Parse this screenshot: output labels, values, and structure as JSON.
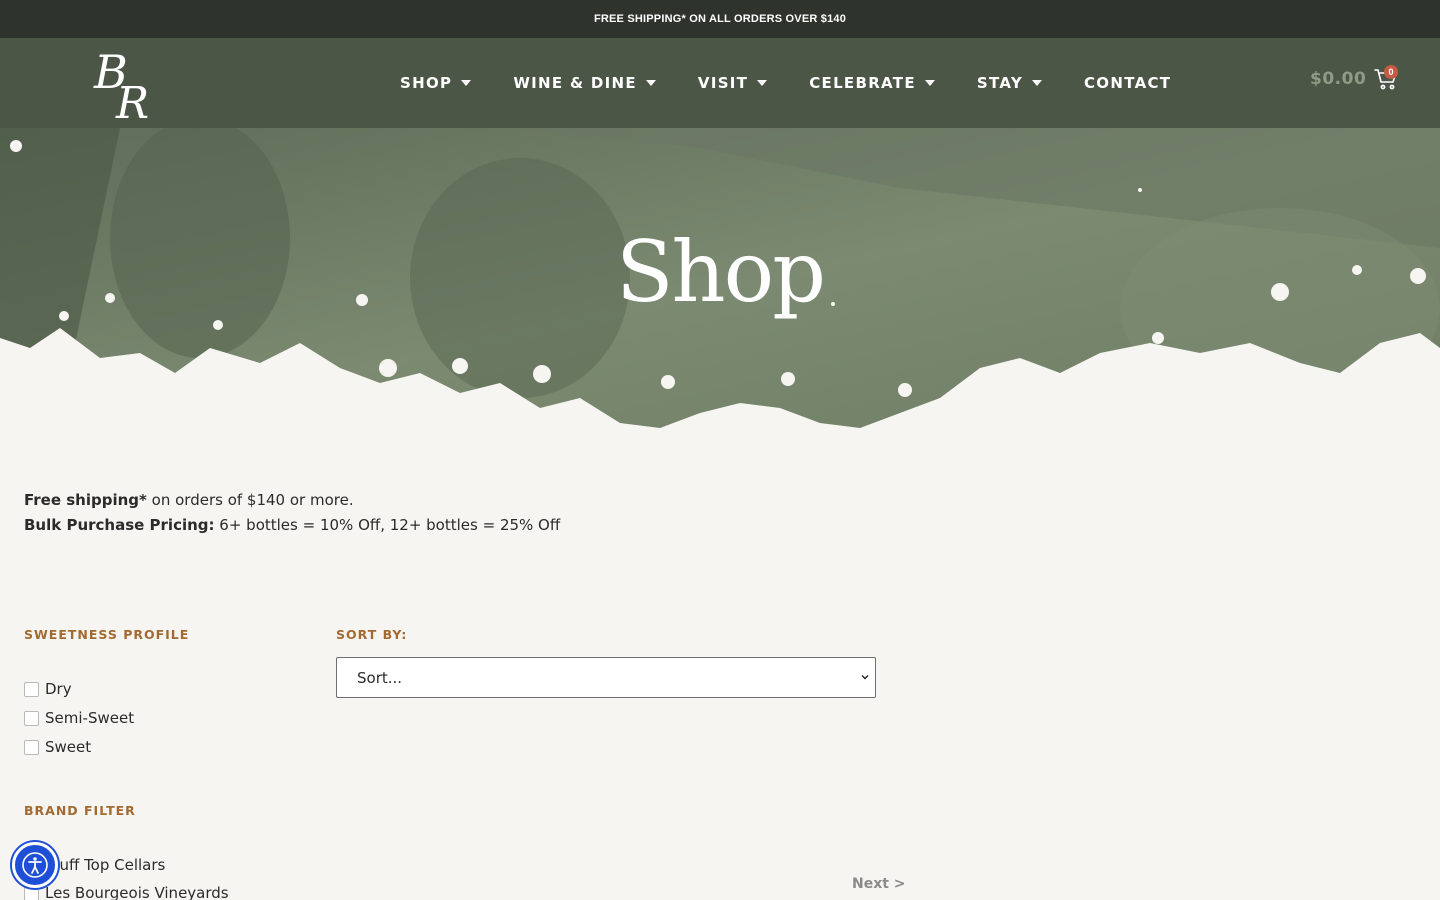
{
  "announcement": "FREE SHIPPING* ON ALL ORDERS OVER $140",
  "header": {
    "logo_text": "BR",
    "nav": [
      {
        "label": "SHOP",
        "has_dropdown": true
      },
      {
        "label": "WINE & DINE",
        "has_dropdown": true
      },
      {
        "label": "VISIT",
        "has_dropdown": true
      },
      {
        "label": "CELEBRATE",
        "has_dropdown": true
      },
      {
        "label": "STAY",
        "has_dropdown": true
      },
      {
        "label": "CONTACT",
        "has_dropdown": false
      }
    ],
    "cart_total": "$0.00",
    "cart_count": "0"
  },
  "hero": {
    "title": "Shop"
  },
  "promo": {
    "line1_bold": "Free shipping*",
    "line1_rest": " on orders of $140 or more.",
    "line2_bold": "Bulk Purchase Pricing:",
    "line2_rest": " 6+ bottles = 10% Off, 12+ bottles = 25% Off"
  },
  "filters": {
    "sweetness_title": "SWEETNESS PROFILE",
    "sweetness_options": [
      "Dry",
      "Semi-Sweet",
      "Sweet"
    ],
    "brand_title": "BRAND FILTER",
    "brand_options": [
      "Bluff Top Cellars",
      "Les Bourgeois Vineyards"
    ]
  },
  "sort": {
    "title": "SORT BY:",
    "value": "Sort..."
  },
  "pagination": {
    "next_label": "Next >"
  },
  "colors": {
    "header_bg": "#4b5646",
    "topbar_bg": "#2e342c",
    "accent": "#a26a30",
    "page_bg": "#f7f5f2",
    "a11y": "#1f4fd6"
  },
  "icons": [
    "logo-monogram-icon",
    "caret-down-icon",
    "cart-icon",
    "chevron-down-icon",
    "accessibility-icon"
  ]
}
